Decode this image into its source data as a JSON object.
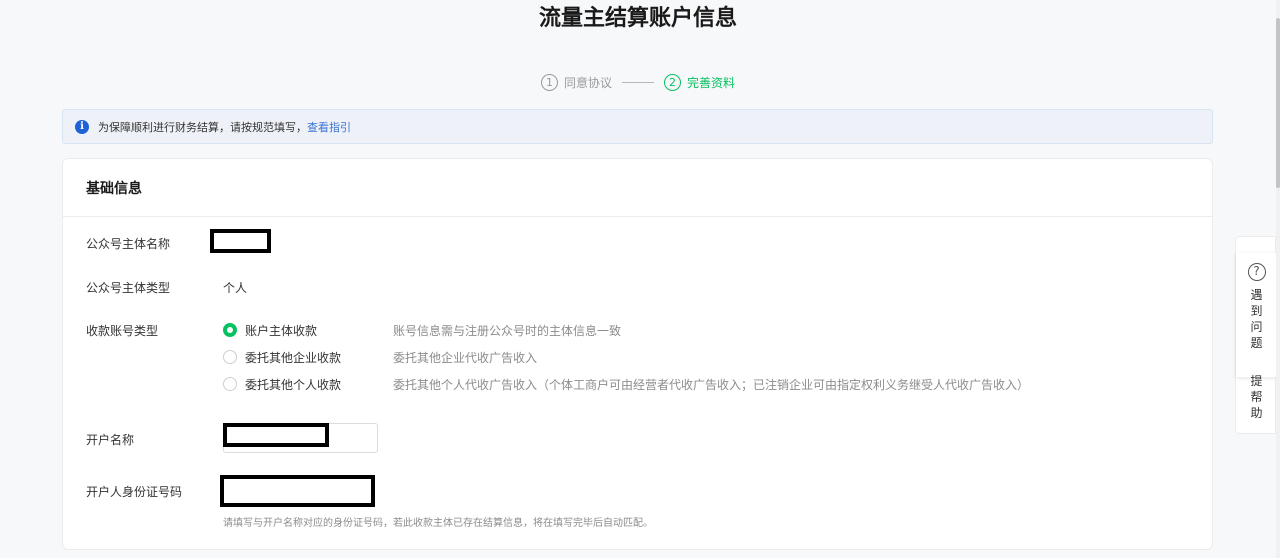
{
  "page": {
    "title": "流量主结算账户信息"
  },
  "steps": [
    {
      "num": "1",
      "label": "同意协议"
    },
    {
      "num": "2",
      "label": "完善资料"
    }
  ],
  "notice": {
    "text": "为保障顺利进行财务结算，请按规范填写，",
    "link": "查看指引"
  },
  "card": {
    "title": "基础信息"
  },
  "fields": {
    "entity_name_label": "公众号主体名称",
    "entity_type_label": "公众号主体类型",
    "entity_type_value": "个人",
    "account_type_label": "收款账号类型",
    "account_name_label": "开户名称",
    "id_number_label": "开户人身份证号码",
    "id_number_hint": "请填写与开户名称对应的身份证号码，若此收款主体已存在结算信息，将在填写完毕后自动匹配。"
  },
  "radio_options": [
    {
      "label": "账户主体收款",
      "desc": "账号信息需与注册公众号时的主体信息一致",
      "checked": true
    },
    {
      "label": "委托其他企业收款",
      "desc": "委托其他企业代收广告收入",
      "checked": false
    },
    {
      "label": "委托其他个人收款",
      "desc": "委托其他个人代收广告收入（个体工商户可由经营者代收广告收入；已注销企业可由指定权利义务继受人代收广告收入）",
      "checked": false
    }
  ],
  "help_widget": {
    "icon": "question-icon",
    "label_top": "遇到问题",
    "label_bottom": "提帮助"
  },
  "colors": {
    "accent": "#07c160",
    "link": "#3a73d3",
    "info": "#1f62d6"
  }
}
